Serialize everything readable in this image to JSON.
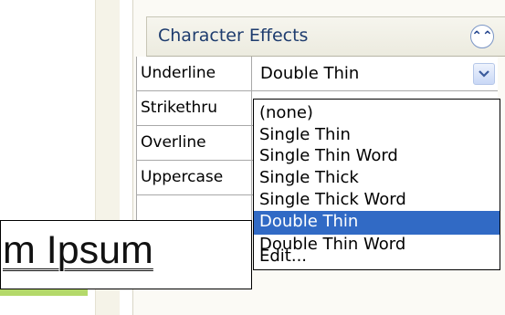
{
  "task_pane": {
    "section_title": "Character Effects",
    "collapse_icon": "double-chevron-up-icon"
  },
  "properties": [
    {
      "label": "Underline",
      "value": "Double Thin"
    },
    {
      "label": "Strikethru",
      "value": ""
    },
    {
      "label": "Overline",
      "value": ""
    },
    {
      "label": "Uppercase",
      "value": ""
    }
  ],
  "dropdown": {
    "open_for": "Underline",
    "selected": "Double Thin",
    "options": [
      "(none)",
      "Single Thin",
      "Single Thin Word",
      "Single Thick",
      "Single Thick Word",
      "Double Thin",
      "Double Thin Word",
      "Edit..."
    ]
  },
  "preview": {
    "text": "m Ipsum"
  },
  "colors": {
    "selection_highlight": "#316ac5",
    "section_title_text": "#1e3c6e",
    "pane_background": "#fbfaf5",
    "accent_bar": "#b4d96a"
  }
}
